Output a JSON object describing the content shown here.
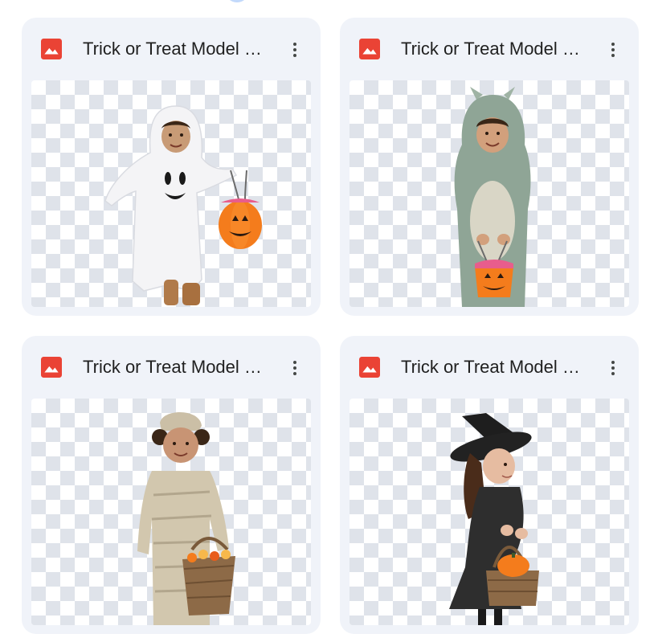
{
  "files": [
    {
      "title": "Trick or Treat Model Ghost.png",
      "thumbnail": "child in white ghost costume holding orange pumpkin candy bucket",
      "menu_icon": "more-vert-icon"
    },
    {
      "title": "Trick or Treat Model Monster.png",
      "thumbnail": "child in green fuzzy monster costume holding pumpkin candy bucket",
      "menu_icon": "more-vert-icon"
    },
    {
      "title": "Trick or Treat Model Mummy.png",
      "thumbnail": "child in mummy costume holding wicker basket of candy",
      "menu_icon": "more-vert-icon"
    },
    {
      "title": "Trick or Treat Model Witch.png",
      "thumbnail": "girl in black witch hat and dress holding basket with pumpkin",
      "menu_icon": "more-vert-icon"
    }
  ],
  "colors": {
    "card_bg": "#f0f3f9",
    "image_icon": "#ea4335",
    "title_text": "#1f1f1f",
    "checker": "#dfe3ea"
  }
}
